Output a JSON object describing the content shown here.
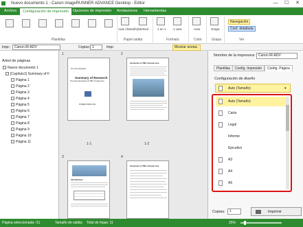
{
  "window": {
    "title": "Nuevo documento 1 - Canon imageRUNNER ADVANCE Desktop - Editor",
    "min": "—",
    "max": "☐",
    "close": "✕"
  },
  "ribbon_tabs": [
    "Archivo",
    "Configuración de impresión",
    "Opciones de impresión",
    "Anotaciones",
    "Herramientas"
  ],
  "ribbon": {
    "group_plantillas": "Plantillas",
    "group_papel": "Papel salida",
    "group_formato": "Formato",
    "group_color": "Color",
    "group_grapa": "Grapa",
    "group_ver": "Ver",
    "auto_tamano": "Auto (Tamaño)",
    "vertical": "Vertical",
    "en1": "1 en 1",
    "cara1": "1 cara",
    "color_auto": "Auto",
    "grapa": "Grapa",
    "navegacion": "Navegación",
    "conf_detallada": "Conf. detallada"
  },
  "toolbar": {
    "impr_label": "Impr.:",
    "impr_value": "Canon iR-ADV",
    "copias_label": "Copias:",
    "copias_value": "1",
    "impr_btn": "Impr.",
    "mostrar": "Mostrar anotac."
  },
  "leftpane": {
    "title": "Árbol de páginas",
    "root": "Nuevo documento 1",
    "chapter": "[Capítulo1] Summary of F",
    "pages": [
      "Página 1",
      "Página 2",
      "Página 3",
      "Página 4",
      "Página 5",
      "Página 6",
      "Página 7",
      "Página 8",
      "Página 9",
      "Página 10",
      "Página 11"
    ]
  },
  "center": {
    "page_nums": [
      "1",
      "2",
      "3",
      "4"
    ],
    "captions": [
      "1-1",
      "1-2"
    ],
    "doc_title": "Summary of Research",
    "doc_subtitle": "The Future Development of TBD of Greater Area",
    "doc_header": "The UK Corporation",
    "doc_footer": "POWER FORUM INC.",
    "p2_title": "Introduction of TBD of Greater Area",
    "p3_title": "Introduction",
    "p4_title": "Introduction of TBD of Greater Area"
  },
  "rightpane": {
    "printer_label": "Nombre de la impresora:",
    "printer_value": "Canon iR-ADV",
    "tabs": [
      "Plantillas",
      "Config. Impresión",
      "Config. Página"
    ],
    "layout_label": "Configuración de diseño",
    "selected": "Auto (Tamaño)",
    "items": [
      "Auto (Tamaño)",
      "Carta",
      "Legal",
      "Informe",
      "Ejecutivo",
      "A3",
      "A4",
      "A5"
    ],
    "copias_label": "Copias:",
    "copias_value": "1",
    "imprimir": "Imprimir"
  },
  "statusbar": {
    "sel": "Página seleccionada: /11",
    "tam": "Tamaño de salida:",
    "total": "Total de hojas: 11",
    "zoom": "25%"
  },
  "colors": {
    "accent": "#2e8b30",
    "highlight": "#d11111",
    "selected_bg": "#fff3a0"
  }
}
